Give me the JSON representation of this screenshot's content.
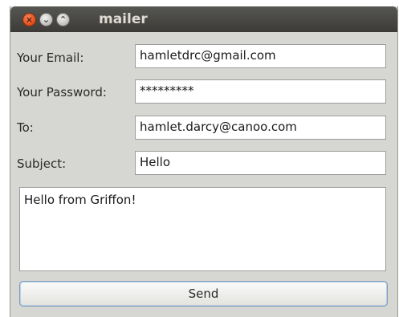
{
  "window": {
    "title": "mailer",
    "controls": {
      "close_icon": "close-icon",
      "minimize_icon": "minimize-icon",
      "maximize_icon": "maximize-icon"
    }
  },
  "form": {
    "email": {
      "label": "Your Email:",
      "value": "hamletdrc@gmail.com"
    },
    "password": {
      "label": "Your Password:",
      "value": "*********"
    },
    "to": {
      "label": "To:",
      "value": "hamlet.darcy@canoo.com"
    },
    "subject": {
      "label": "Subject:",
      "value": "Hello"
    },
    "message": {
      "value": "Hello from Griffon!"
    },
    "send_label": "Send"
  },
  "colors": {
    "titlebar": "#3c3b37",
    "close_button": "#df4b16",
    "window_bg": "#d6d6d2",
    "button_border": "#7f9db9"
  }
}
